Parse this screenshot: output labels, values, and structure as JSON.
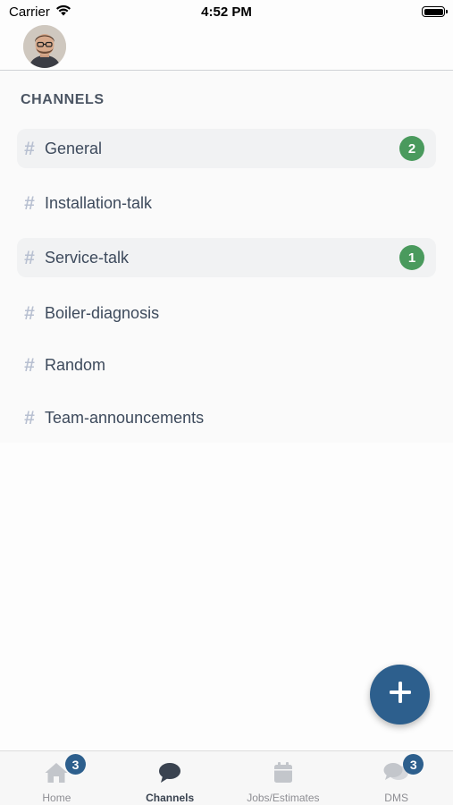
{
  "status_bar": {
    "carrier": "Carrier",
    "time": "4:52 PM",
    "icons": [
      "wifi-icon",
      "battery-icon"
    ]
  },
  "header": {
    "avatar": "user-avatar"
  },
  "channels": {
    "section_title": "CHANNELS",
    "items": [
      {
        "name": "General",
        "unread": "2",
        "highlighted": true
      },
      {
        "name": "Installation-talk",
        "unread": null,
        "highlighted": false
      },
      {
        "name": "Service-talk",
        "unread": "1",
        "highlighted": true
      },
      {
        "name": "Boiler-diagnosis",
        "unread": null,
        "highlighted": false
      },
      {
        "name": "Random",
        "unread": null,
        "highlighted": false
      },
      {
        "name": "Team-announcements",
        "unread": null,
        "highlighted": false
      }
    ],
    "hash_symbol": "#"
  },
  "fab": {
    "icon": "plus-icon"
  },
  "tab_bar": {
    "tabs": [
      {
        "label": "Home",
        "icon": "home-icon",
        "badge": "3",
        "active": false
      },
      {
        "label": "Channels",
        "icon": "chat-bubble-icon",
        "badge": null,
        "active": true
      },
      {
        "label": "Jobs/Estimates",
        "icon": "calendar-icon",
        "badge": null,
        "active": false
      },
      {
        "label": "DMS",
        "icon": "messages-icon",
        "badge": "3",
        "active": false
      }
    ]
  },
  "colors": {
    "accent": "#2d5f8d",
    "unread_badge": "#4a9a5d",
    "hash": "#b8c0d1",
    "channel_text": "#3d4a5c"
  }
}
